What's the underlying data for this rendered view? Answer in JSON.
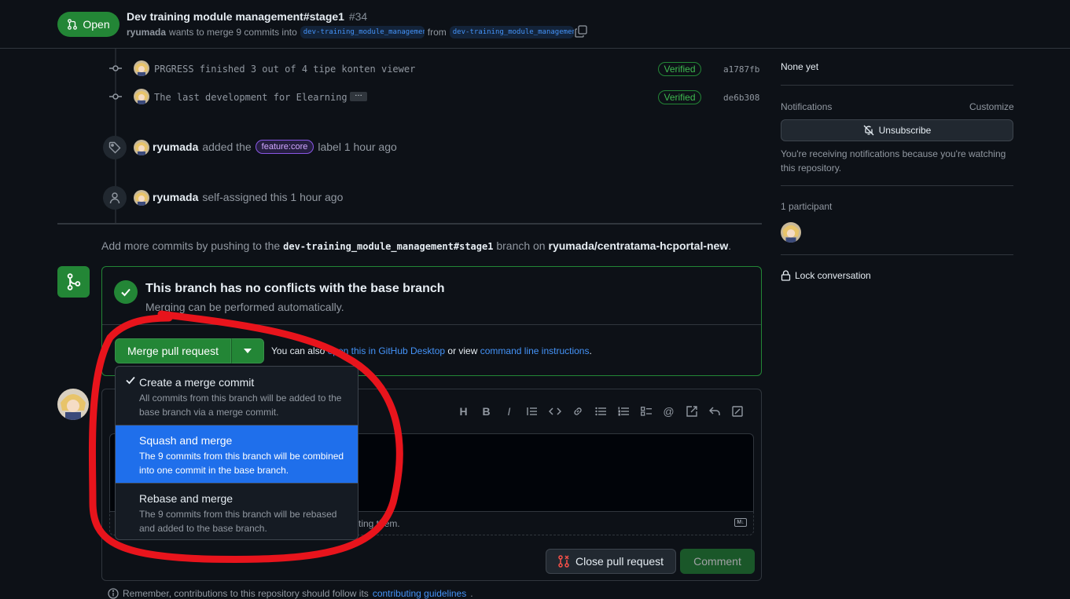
{
  "header": {
    "status": "Open",
    "title": "Dev training module management#stage1",
    "number": "#34",
    "author": "ryumada",
    "merge_text": "wants to merge 9 commits into",
    "base_branch": "dev-training_module_management",
    "from_text": "from",
    "head_branch": "dev-training_module_managemen…"
  },
  "timeline": {
    "commits": [
      {
        "message": "PRGRESS finished 3 out of 4 tipe konten viewer",
        "verified": "Verified",
        "sha": "a1787fb"
      },
      {
        "message": "The last development for Elearning",
        "verified": "Verified",
        "sha": "de6b308",
        "ellipsis": "…"
      }
    ],
    "label_event": {
      "user": "ryumada",
      "before": "added the",
      "label": "feature:core",
      "after": "label 1 hour ago"
    },
    "assign_event": {
      "user": "ryumada",
      "text": "self-assigned this 1 hour ago"
    },
    "more_commits": {
      "prefix": "Add more commits by pushing to the",
      "branch": "dev-training_module_management#stage1",
      "middle": "branch on",
      "repo": "ryumada/centratama-hcportal-new",
      "suffix": "."
    }
  },
  "merge_box": {
    "heading": "This branch has no conflicts with the base branch",
    "sub": "Merging can be performed automatically.",
    "merge_button": "Merge pull request",
    "also_prefix": "You can also",
    "also_link": "open this in GitHub Desktop",
    "also_middle": "or view",
    "also_link2": "command line instructions",
    "also_suffix": "."
  },
  "dropdown": {
    "items": [
      {
        "title": "Create a merge commit",
        "desc": "All commits from this branch will be added to the base branch via a merge commit.",
        "selected": true
      },
      {
        "title": "Squash and merge",
        "desc": "The 9 commits from this branch will be combined into one commit in the base branch.",
        "active": true
      },
      {
        "title": "Rebase and merge",
        "desc": "The 9 commits from this branch will be rebased and added to the base branch."
      }
    ]
  },
  "comment": {
    "attach_text": "sting them.",
    "md_label": "M↓",
    "close_button": "Close pull request",
    "comment_button": "Comment",
    "remember_prefix": "Remember, contributions to this repository should follow its",
    "remember_link": "contributing guidelines",
    "remember_suffix": "."
  },
  "sidebar": {
    "milestone": "None yet",
    "notifications_heading": "Notifications",
    "customize": "Customize",
    "unsubscribe": "Unsubscribe",
    "notif_reason": "You're receiving notifications because you're watching this repository.",
    "participants": "1 participant",
    "lock": "Lock conversation"
  },
  "colors": {
    "green": "#238636",
    "accent": "#1f6feb",
    "annotation_red": "#e8141c"
  }
}
